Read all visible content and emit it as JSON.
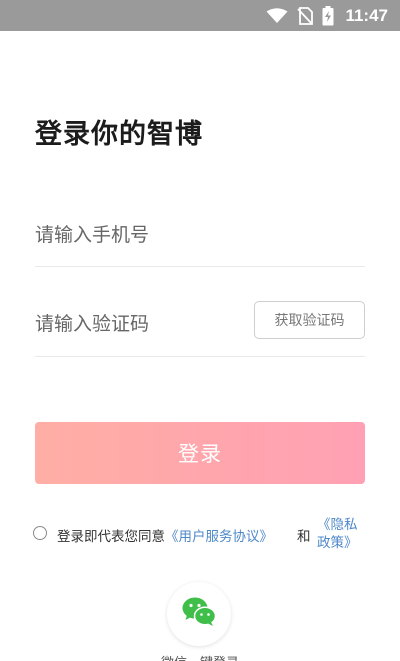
{
  "status_bar": {
    "time": "11:47",
    "icons": [
      "wifi-icon",
      "no-sim-icon",
      "battery-charging-icon"
    ]
  },
  "page": {
    "title": "登录你的智博"
  },
  "form": {
    "phone_placeholder": "请输入手机号",
    "code_placeholder": "请输入验证码",
    "get_code_label": "获取验证码",
    "login_label": "登录"
  },
  "agreement": {
    "prefix": "登录即代表您同意",
    "user_agreement": "《用户服务协议》",
    "and": "和",
    "privacy_line1": "《隐私",
    "privacy_line2": "政策》"
  },
  "wechat": {
    "label": "微信一键登录",
    "icon": "wechat-icon"
  },
  "colors": {
    "status_bar": "#9a9a9a",
    "login_gradient_start": "#ffaaa0",
    "login_gradient_end": "#ff9bb0",
    "link": "#4f88c9",
    "wechat_green": "#3fbf4a"
  }
}
